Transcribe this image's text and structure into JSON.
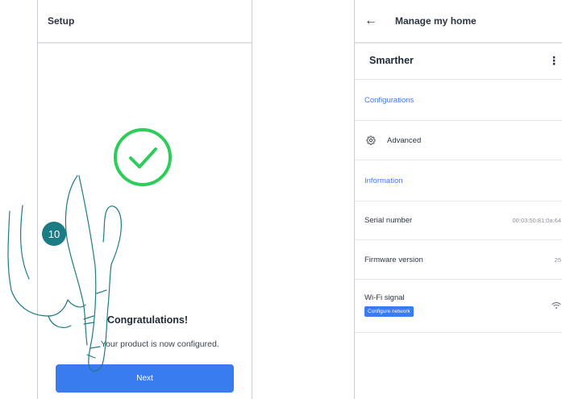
{
  "left_screen": {
    "header_title": "Setup",
    "congrats_title": "Congratulations!",
    "configured_text": "Your product is now configured.",
    "next_label": "Next",
    "step_number": "10"
  },
  "right_screen": {
    "header_back_icon": "arrow-left-icon",
    "header_title": "Manage my home",
    "home_name": "Smarther",
    "menu_icon": "kebab-menu-icon",
    "configurations_title": "Configurations",
    "advanced_label": "Advanced",
    "information_title": "Information",
    "serial_label": "Serial number",
    "serial_value": "00:03:50:81:0a:64",
    "firmware_label": "Firmware version",
    "firmware_value": "25",
    "wifi_label": "Wi-Fi signal",
    "configure_network_label": "Configure network",
    "wifi_icon": "wifi-icon"
  },
  "colors": {
    "accent": "#3a7bf0",
    "success": "#2ecc5a",
    "step_badge": "#1c7c83",
    "hand_outline": "#1c7c83"
  }
}
